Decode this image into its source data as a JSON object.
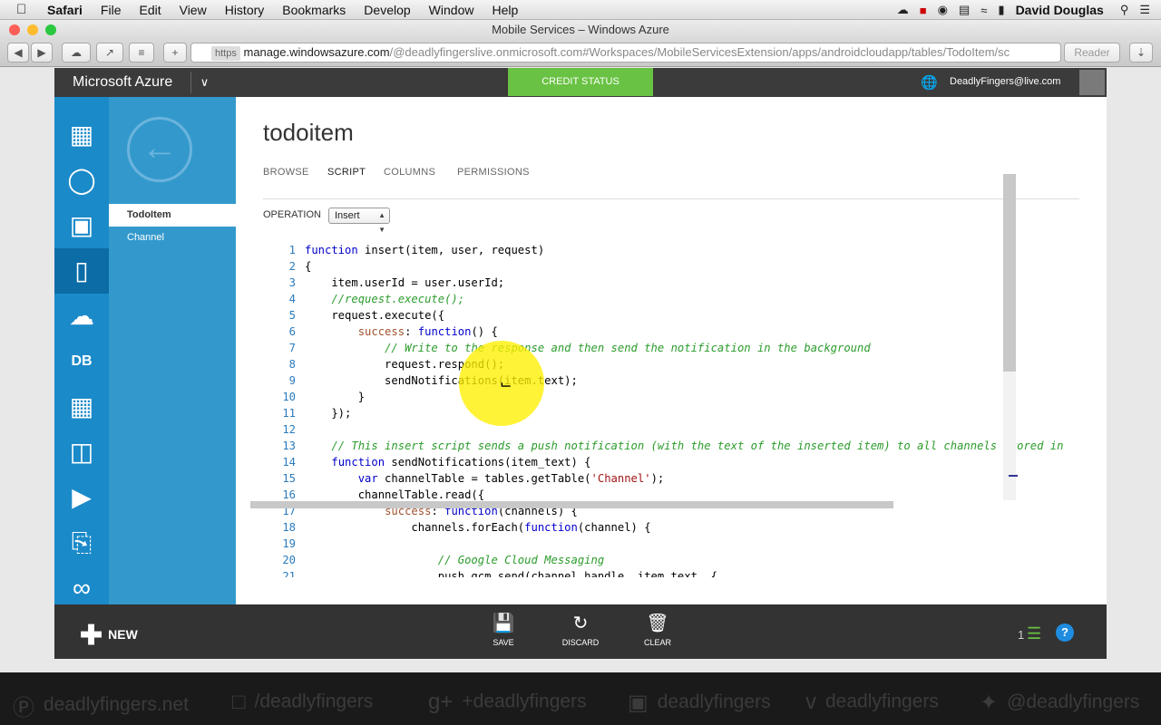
{
  "menubar": {
    "apple": "",
    "items": [
      "Safari",
      "File",
      "Edit",
      "View",
      "History",
      "Bookmarks",
      "Develop",
      "Window",
      "Help"
    ],
    "user": "David Douglas"
  },
  "browser": {
    "window_title": "Mobile Services – Windows Azure",
    "https": "https",
    "url_host": "manage.windowsazure.com",
    "url_path": "/@deadlyfingerslive.onmicrosoft.com#Workspaces/MobileServicesExtension/apps/androidcloudapp/tables/TodoItem/sc",
    "reader": "Reader"
  },
  "portal": {
    "brand": "Microsoft Azure",
    "credit_status": "CREDIT STATUS",
    "account": "DeadlyFingers@live.com"
  },
  "subnav": {
    "items": [
      "TodoItem",
      "Channel"
    ]
  },
  "page": {
    "title": "todoitem",
    "tabs": [
      "BROWSE",
      "SCRIPT",
      "COLUMNS",
      "PERMISSIONS"
    ],
    "operation_label": "OPERATION",
    "operation_value": "Insert"
  },
  "code": {
    "lines": [
      {
        "n": "1",
        "segs": [
          [
            "kw",
            "function"
          ],
          [
            "t",
            " insert(item, user, request)"
          ]
        ]
      },
      {
        "n": "2",
        "segs": [
          [
            "t",
            "{"
          ]
        ]
      },
      {
        "n": "3",
        "segs": [
          [
            "t",
            "    item.userId = user.userId;"
          ]
        ]
      },
      {
        "n": "4",
        "segs": [
          [
            "t",
            "    "
          ],
          [
            "cm",
            "//request.execute();"
          ]
        ]
      },
      {
        "n": "5",
        "segs": [
          [
            "t",
            "    request.execute({"
          ]
        ]
      },
      {
        "n": "6",
        "segs": [
          [
            "t",
            "        "
          ],
          [
            "pp",
            "success"
          ],
          [
            "t",
            ": "
          ],
          [
            "kw",
            "function"
          ],
          [
            "t",
            "() {"
          ]
        ]
      },
      {
        "n": "7",
        "segs": [
          [
            "t",
            "            "
          ],
          [
            "cm",
            "// Write to the response and then send the notification in the background"
          ]
        ]
      },
      {
        "n": "8",
        "segs": [
          [
            "t",
            "            request.respond();"
          ]
        ]
      },
      {
        "n": "9",
        "segs": [
          [
            "t",
            "            sendNotifications(item.text);"
          ]
        ]
      },
      {
        "n": "10",
        "segs": [
          [
            "t",
            "        }"
          ]
        ]
      },
      {
        "n": "11",
        "segs": [
          [
            "t",
            "    });"
          ]
        ]
      },
      {
        "n": "12",
        "segs": [
          [
            "t",
            ""
          ]
        ]
      },
      {
        "n": "13",
        "segs": [
          [
            "t",
            "    "
          ],
          [
            "cm",
            "// This insert script sends a push notification (with the text of the inserted item) to all channels stored in th"
          ]
        ]
      },
      {
        "n": "14",
        "segs": [
          [
            "t",
            "    "
          ],
          [
            "kw",
            "function"
          ],
          [
            "t",
            " sendNotifications(item_text) {"
          ]
        ]
      },
      {
        "n": "15",
        "segs": [
          [
            "t",
            "        "
          ],
          [
            "kw",
            "var"
          ],
          [
            "t",
            " channelTable = tables.getTable("
          ],
          [
            "st",
            "'Channel'"
          ],
          [
            "t",
            ");"
          ]
        ]
      },
      {
        "n": "16",
        "segs": [
          [
            "t",
            "        channelTable.read({"
          ]
        ]
      },
      {
        "n": "17",
        "segs": [
          [
            "t",
            "            "
          ],
          [
            "pp",
            "success"
          ],
          [
            "t",
            ": "
          ],
          [
            "kw",
            "function"
          ],
          [
            "t",
            "(channels) {"
          ]
        ]
      },
      {
        "n": "18",
        "segs": [
          [
            "t",
            "                channels.forEach("
          ],
          [
            "kw",
            "function"
          ],
          [
            "t",
            "(channel) {"
          ]
        ]
      },
      {
        "n": "19",
        "segs": [
          [
            "t",
            ""
          ]
        ]
      },
      {
        "n": "20",
        "segs": [
          [
            "t",
            "                    "
          ],
          [
            "cm",
            "// Google Cloud Messaging"
          ]
        ]
      },
      {
        "n": "21",
        "segs": [
          [
            "t",
            "                    push.gcm.send(channel.handle, item.text, {"
          ]
        ]
      }
    ]
  },
  "commands": {
    "new": "NEW",
    "save": "SAVE",
    "discard": "DISCARD",
    "clear": "CLEAR",
    "count": "1",
    "help": "?"
  },
  "social": [
    {
      "icon": "wordpress-icon",
      "text": "deadlyfingers.net"
    },
    {
      "icon": "facebook-icon",
      "text": "/deadlyfingers"
    },
    {
      "icon": "google-plus-icon",
      "text": "+deadlyfingers"
    },
    {
      "icon": "instagram-icon",
      "text": "deadlyfingers"
    },
    {
      "icon": "vimeo-icon",
      "text": "deadlyfingers"
    },
    {
      "icon": "twitter-icon",
      "text": "@deadlyfingers"
    }
  ],
  "colors": {
    "azure_blue": "#1b8ac9",
    "credit_green": "#69c243",
    "top_nav": "#3b3b3b",
    "cmd_bar": "#333333"
  }
}
